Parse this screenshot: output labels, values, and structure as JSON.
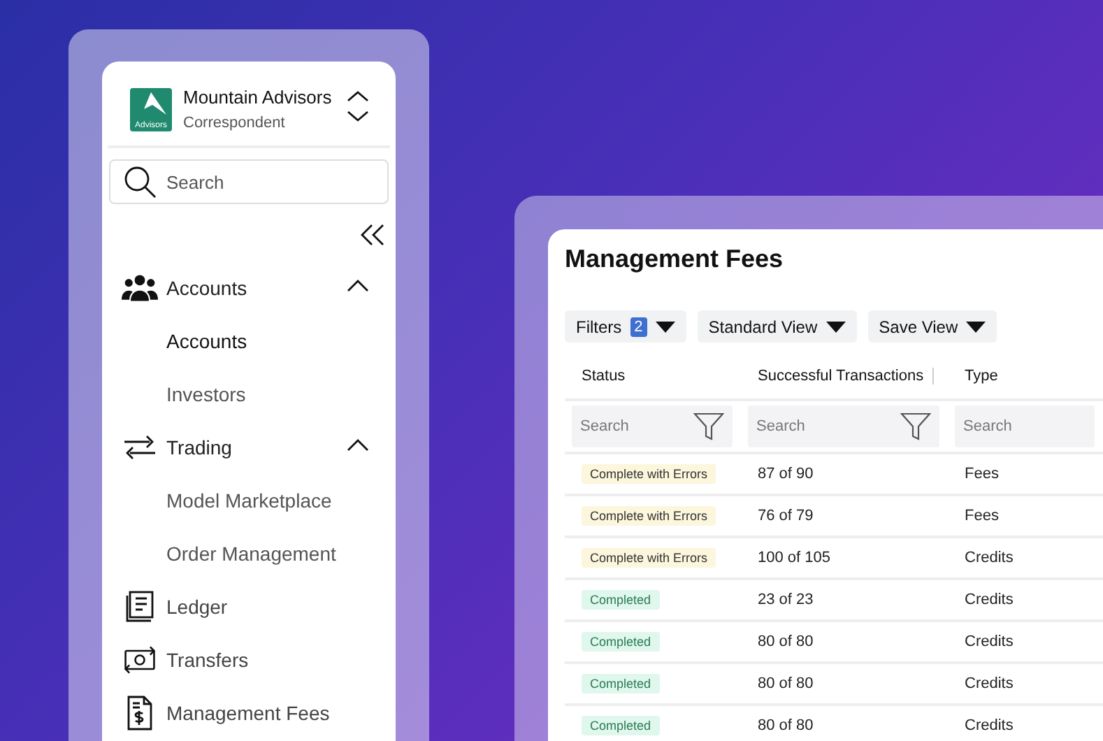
{
  "sidebar": {
    "org": {
      "name": "Mountain Advisors",
      "role": "Correspondent",
      "logo_text": "Advisors"
    },
    "search": {
      "placeholder": "Search"
    },
    "items": [
      {
        "label": "Accounts",
        "expanded": true,
        "children": [
          {
            "label": "Accounts",
            "selected": true
          },
          {
            "label": "Investors",
            "selected": false
          }
        ]
      },
      {
        "label": "Trading",
        "expanded": true,
        "children": [
          {
            "label": "Model Marketplace",
            "selected": false
          },
          {
            "label": "Order Management",
            "selected": false
          }
        ]
      },
      {
        "label": "Ledger"
      },
      {
        "label": "Transfers"
      },
      {
        "label": "Management Fees"
      }
    ]
  },
  "page": {
    "title": "Management Fees",
    "toolbar": [
      {
        "label": "Filters",
        "badge": "2"
      },
      {
        "label": "Standard View"
      },
      {
        "label": "Save View"
      }
    ],
    "table": {
      "columns": [
        {
          "label": "Status",
          "placeholder": "Search",
          "filter": true
        },
        {
          "label": "Successful Transactions",
          "placeholder": "Search",
          "filter": true
        },
        {
          "label": "Type",
          "placeholder": "Search",
          "filter": false
        }
      ],
      "rows": [
        {
          "status": "Complete with Errors",
          "kind": "warning",
          "transactions": "87 of 90",
          "type": "Fees"
        },
        {
          "status": "Complete with Errors",
          "kind": "warning",
          "transactions": "76 of 79",
          "type": "Fees"
        },
        {
          "status": "Complete with Errors",
          "kind": "warning",
          "transactions": "100 of 105",
          "type": "Credits"
        },
        {
          "status": "Completed",
          "kind": "success",
          "transactions": "23 of 23",
          "type": "Credits"
        },
        {
          "status": "Completed",
          "kind": "success",
          "transactions": "80 of 80",
          "type": "Credits"
        },
        {
          "status": "Completed",
          "kind": "success",
          "transactions": "80 of 80",
          "type": "Credits"
        },
        {
          "status": "Completed",
          "kind": "success",
          "transactions": "80 of 80",
          "type": "Credits"
        }
      ]
    }
  }
}
